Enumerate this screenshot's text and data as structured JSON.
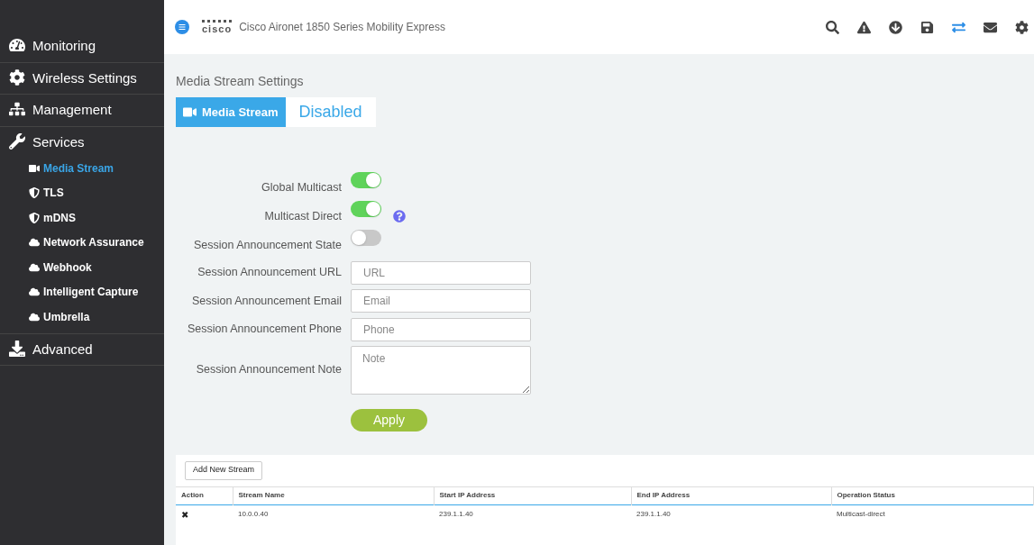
{
  "header": {
    "logo": "cisco",
    "title": "Cisco Aironet 1850 Series Mobility Express"
  },
  "sidebar": {
    "items": [
      {
        "label": "Monitoring",
        "selected": false
      },
      {
        "label": "Wireless Settings",
        "selected": false
      },
      {
        "label": "Management",
        "selected": false
      },
      {
        "label": "Services",
        "selected": false,
        "expanded": true,
        "children": [
          {
            "label": "Media Stream",
            "selected": true
          },
          {
            "label": "TLS",
            "selected": false
          },
          {
            "label": "mDNS",
            "selected": false
          },
          {
            "label": "Network Assurance",
            "selected": false
          },
          {
            "label": "Webhook",
            "selected": false
          },
          {
            "label": "Intelligent Capture",
            "selected": false
          },
          {
            "label": "Umbrella",
            "selected": false
          }
        ]
      },
      {
        "label": "Advanced",
        "selected": false
      }
    ]
  },
  "page_title": "Media Stream Settings",
  "banner": {
    "label": "Media Stream",
    "status": "Disabled"
  },
  "form": [
    {
      "kind": "toggle",
      "label": "Global Multicast",
      "on": true,
      "help": false
    },
    {
      "kind": "toggle",
      "label": "Multicast Direct",
      "on": true,
      "help": true
    },
    {
      "kind": "toggle",
      "label": "Session Announcement State",
      "on": false,
      "help": false
    },
    {
      "kind": "input",
      "label": "Session Announcement URL",
      "placeholder": "URL"
    },
    {
      "kind": "input",
      "label": "Session Announcement Email",
      "placeholder": "Email"
    },
    {
      "kind": "input",
      "label": "Session Announcement Phone",
      "placeholder": "Phone"
    },
    {
      "kind": "textarea",
      "label": "Session Announcement Note",
      "placeholder": "Note"
    }
  ],
  "apply_button": "Apply",
  "add_button": "Add New Stream",
  "table": {
    "columns": [
      "Action",
      "Stream Name",
      "Start IP Address",
      "End IP Address",
      "Operation Status"
    ],
    "rows": [
      {
        "cells": [
          "✖",
          "10.0.0.40",
          "239.1.1.40",
          "239.1.1.40",
          "Multicast-direct"
        ]
      }
    ]
  }
}
